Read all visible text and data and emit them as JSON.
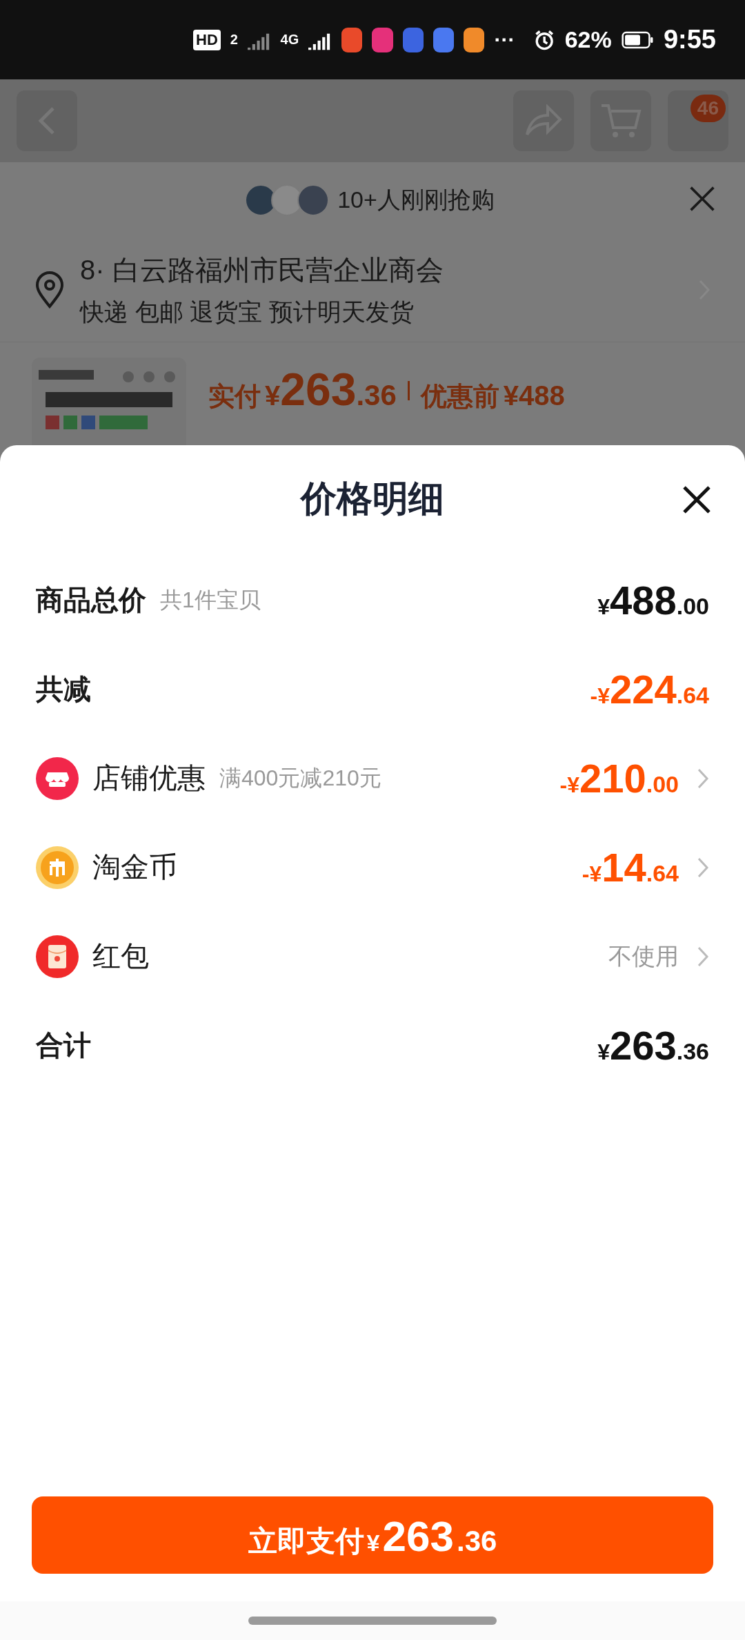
{
  "status_bar": {
    "hd": "HD",
    "sim": "2",
    "network": "4G",
    "more": "···",
    "battery": "62%",
    "time": "9:55"
  },
  "background_page": {
    "cart_badge": "46",
    "buyers": "10+人刚刚抢购",
    "address": {
      "line": "8· 白云路福州市民营企业商会",
      "shipping": "快递 包邮 退货宝 预计明天发货"
    },
    "product": {
      "paid_label": "实付",
      "price": {
        "currency": "¥",
        "integer": "263",
        "decimal": ".36"
      },
      "original_label": "优惠前",
      "original_price": "¥488"
    }
  },
  "sheet": {
    "title": "价格明细",
    "rows": [
      {
        "kind": "total",
        "label": "商品总价",
        "note": "共1件宝贝",
        "amount": {
          "currency": "¥",
          "integer": "488",
          "decimal": ".00"
        }
      },
      {
        "kind": "total",
        "label": "共减",
        "amount": {
          "sign": "-",
          "currency": "¥",
          "integer": "224",
          "decimal": ".64"
        }
      },
      {
        "kind": "item",
        "label": "店铺优惠",
        "note": "满400元减210元",
        "amount": {
          "sign": "-",
          "currency": "¥",
          "integer": "210",
          "decimal": ".00"
        }
      },
      {
        "kind": "item",
        "label": "淘金币",
        "amount": {
          "sign": "-",
          "currency": "¥",
          "integer": "14",
          "decimal": ".64"
        }
      },
      {
        "kind": "item",
        "label": "红包",
        "value": "不使用"
      },
      {
        "kind": "total",
        "label": "合计",
        "amount": {
          "currency": "¥",
          "integer": "263",
          "decimal": ".36"
        }
      }
    ],
    "pay_button": {
      "label": "立即支付",
      "price": {
        "currency": "¥",
        "integer": "263",
        "decimal": ".36"
      }
    }
  }
}
